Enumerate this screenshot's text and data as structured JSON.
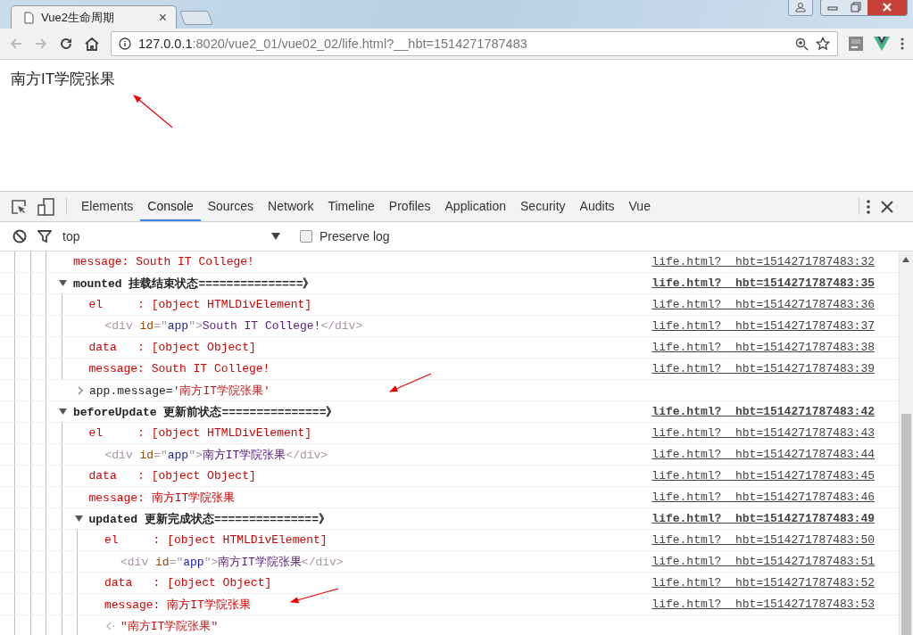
{
  "browser": {
    "tab": {
      "title": "Vue2生命周期",
      "close": "×"
    },
    "address": {
      "host": "127.0.0.1",
      "rest": ":8020/vue2_01/vue02_02/life.html?__hbt=1514271787483"
    }
  },
  "page": {
    "heading": "南方IT学院张果"
  },
  "devtools": {
    "tabs": [
      {
        "label": "Elements",
        "selected": false
      },
      {
        "label": "Console",
        "selected": true
      },
      {
        "label": "Sources",
        "selected": false
      },
      {
        "label": "Network",
        "selected": false
      },
      {
        "label": "Timeline",
        "selected": false
      },
      {
        "label": "Profiles",
        "selected": false
      },
      {
        "label": "Application",
        "selected": false
      },
      {
        "label": "Security",
        "selected": false
      },
      {
        "label": "Audits",
        "selected": false
      },
      {
        "label": "Vue",
        "selected": false
      }
    ],
    "filter": {
      "context": "top",
      "preserve_log": {
        "label": "Preserve log",
        "checked": false
      }
    },
    "console": [
      {
        "kind": "log",
        "text": "message: South IT College!",
        "source": "life.html?__hbt=1514271787483:32"
      },
      {
        "kind": "group",
        "text": "mounted 挂载结束状态===============》",
        "expanded": true,
        "source": "life.html?__hbt=1514271787483:35",
        "children": [
          {
            "kind": "log",
            "text": "el     : [object HTMLDivElement]",
            "source": "life.html?__hbt=1514271787483:36"
          },
          {
            "kind": "element",
            "parts": [
              {
                "t": "<div ",
                "kind": "tag"
              },
              {
                "t": "id",
                "kind": "attr"
              },
              {
                "t": "=\"",
                "kind": "tag"
              },
              {
                "t": "app",
                "kind": "val"
              },
              {
                "t": "\">",
                "kind": "tag"
              },
              {
                "t": "South IT College!",
                "kind": "text"
              },
              {
                "t": "</div>",
                "kind": "tag"
              }
            ],
            "source": "life.html?__hbt=1514271787483:37"
          },
          {
            "kind": "log",
            "text": "data   : [object Object]",
            "source": "life.html?__hbt=1514271787483:38"
          },
          {
            "kind": "log",
            "text": "message: South IT College!",
            "source": "life.html?__hbt=1514271787483:39"
          }
        ]
      },
      {
        "kind": "command",
        "parts": [
          {
            "t": "app.message=",
            "kind": "code"
          },
          {
            "t": "'南方IT学院张果'",
            "kind": "string"
          }
        ]
      },
      {
        "kind": "group",
        "text": "beforeUpdate 更新前状态===============》",
        "expanded": true,
        "source": "life.html?__hbt=1514271787483:42",
        "children": [
          {
            "kind": "log",
            "text": "el     : [object HTMLDivElement]",
            "source": "life.html?__hbt=1514271787483:43"
          },
          {
            "kind": "element",
            "parts": [
              {
                "t": "<div ",
                "kind": "tag"
              },
              {
                "t": "id",
                "kind": "attr"
              },
              {
                "t": "=\"",
                "kind": "tag"
              },
              {
                "t": "app",
                "kind": "val"
              },
              {
                "t": "\">",
                "kind": "tag"
              },
              {
                "t": "南方IT学院张果",
                "kind": "text"
              },
              {
                "t": "</div>",
                "kind": "tag"
              }
            ],
            "source": "life.html?__hbt=1514271787483:44"
          },
          {
            "kind": "log",
            "text": "data   : [object Object]",
            "source": "life.html?__hbt=1514271787483:45"
          },
          {
            "kind": "log",
            "text": "message: 南方IT学院张果",
            "source": "life.html?__hbt=1514271787483:46"
          },
          {
            "kind": "group",
            "text": "updated 更新完成状态===============》",
            "expanded": true,
            "source": "life.html?__hbt=1514271787483:49",
            "children": [
              {
                "kind": "log",
                "text": "el     : [object HTMLDivElement]",
                "source": "life.html?__hbt=1514271787483:50"
              },
              {
                "kind": "element",
                "parts": [
                  {
                    "t": "<div ",
                    "kind": "tag"
                  },
                  {
                    "t": "id",
                    "kind": "attr"
                  },
                  {
                    "t": "=\"",
                    "kind": "tag"
                  },
                  {
                    "t": "app",
                    "kind": "val"
                  },
                  {
                    "t": "\">",
                    "kind": "tag"
                  },
                  {
                    "t": "南方IT学院张果",
                    "kind": "text"
                  },
                  {
                    "t": "</div>",
                    "kind": "tag"
                  }
                ],
                "source": "life.html?__hbt=1514271787483:51"
              },
              {
                "kind": "log",
                "text": "data   : [object Object]",
                "source": "life.html?__hbt=1514271787483:52"
              },
              {
                "kind": "log",
                "text": "message: 南方IT学院张果",
                "source": "life.html?__hbt=1514271787483:53"
              },
              {
                "kind": "result",
                "parts": [
                  {
                    "t": "\"南方IT学院张果\"",
                    "kind": "string"
                  }
                ]
              }
            ]
          }
        ]
      }
    ]
  }
}
